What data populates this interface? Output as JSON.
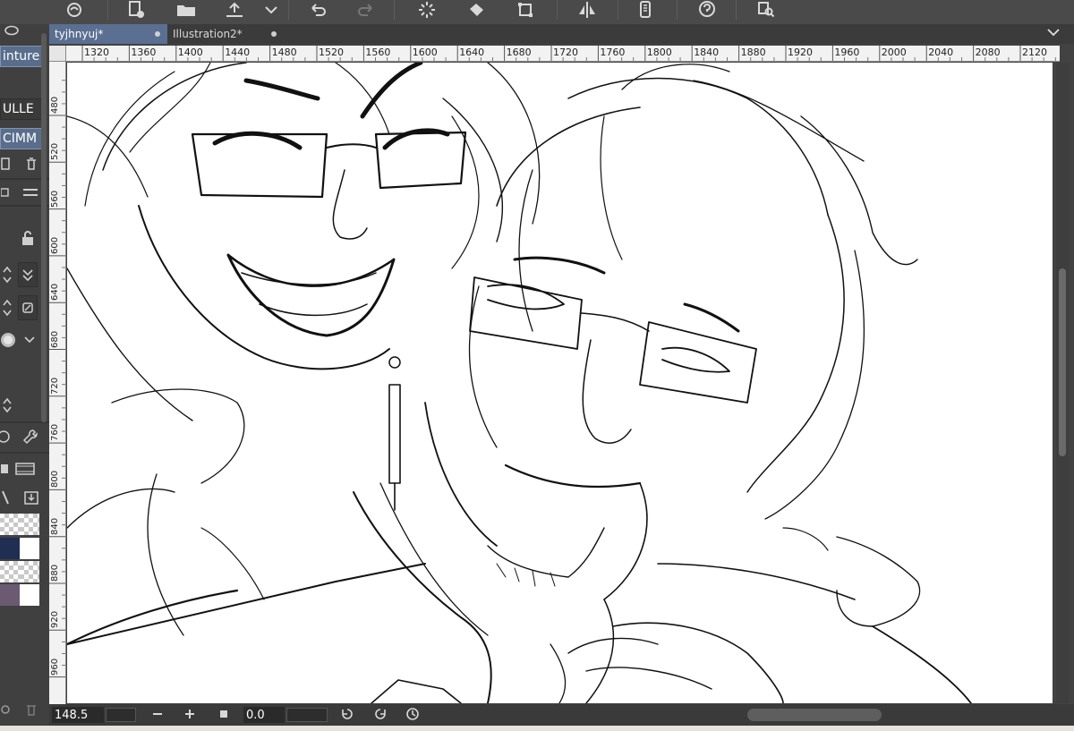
{
  "tabs": [
    {
      "label": "tyjhnyuj*",
      "active": true
    },
    {
      "label": "Illustration2*",
      "active": false
    }
  ],
  "left_panel": {
    "buttons": [
      {
        "label": "inture E",
        "active": true
      },
      {
        "label": "ULLE",
        "active": false
      },
      {
        "label": "CIMM",
        "active": true
      }
    ]
  },
  "ruler_top": [
    "1320",
    "1360",
    "1400",
    "1440",
    "1480",
    "1520",
    "1560",
    "1600",
    "1640",
    "1680",
    "1720",
    "1760",
    "1800",
    "1840",
    "1880",
    "1920",
    "1960",
    "2000",
    "2040",
    "2080",
    "2120"
  ],
  "ruler_left": [
    "480",
    "520",
    "560",
    "600",
    "640",
    "680",
    "720",
    "760",
    "800",
    "840",
    "880",
    "920",
    "960"
  ],
  "status": {
    "zoom": "148.5",
    "angle": "0.0"
  },
  "colors": {
    "accent": "#5a6f92",
    "swatch_navy": "#1f2e52",
    "swatch_mauve": "#6b5a72"
  }
}
